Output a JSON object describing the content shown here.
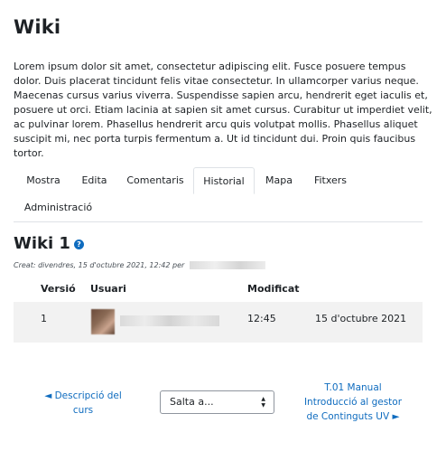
{
  "page": {
    "title": "Wiki",
    "intro": "Lorem ipsum dolor sit amet, consectetur adipiscing elit. Fusce posuere tempus dolor. Duis placerat tincidunt felis vitae consectetur. In ullamcorper varius neque. Maecenas cursus varius viverra. Suspendisse sapien arcu, hendrerit eget iaculis et, posuere ut orci. Etiam lacinia at sapien sit amet cursus. Curabitur ut imperdiet velit, ac pulvinar lorem. Phasellus hendrerit arcu quis volutpat mollis. Phasellus aliquet suscipit mi, nec porta turpis fermentum a. Ut id tincidunt dui. Proin quis faucibus tortor."
  },
  "tabs": [
    {
      "label": "Mostra",
      "active": false
    },
    {
      "label": "Edita",
      "active": false
    },
    {
      "label": "Comentaris",
      "active": false
    },
    {
      "label": "Historial",
      "active": true
    },
    {
      "label": "Mapa",
      "active": false
    },
    {
      "label": "Fitxers",
      "active": false
    },
    {
      "label": "Administració",
      "active": false
    }
  ],
  "wiki": {
    "heading": "Wiki 1",
    "help_icon": "question-circle-icon",
    "created_prefix": "Creat: divendres, 15 d'octubre 2021, 12:42 per"
  },
  "history_table": {
    "columns": [
      "Versió",
      "Usuari",
      "Modificat",
      ""
    ],
    "rows": [
      {
        "version": "1",
        "user": "",
        "time": "12:45",
        "date": "15 d'octubre 2021"
      }
    ]
  },
  "navigation": {
    "prev_label": "◄ Descripció del curs",
    "jump_label": "Salta a...",
    "next_label": "T.01 Manual Introducció al gestor de Continguts UV ►"
  },
  "colors": {
    "link": "#0f6cbf",
    "row_bg": "#f2f2f2",
    "border": "#dee2e6"
  }
}
